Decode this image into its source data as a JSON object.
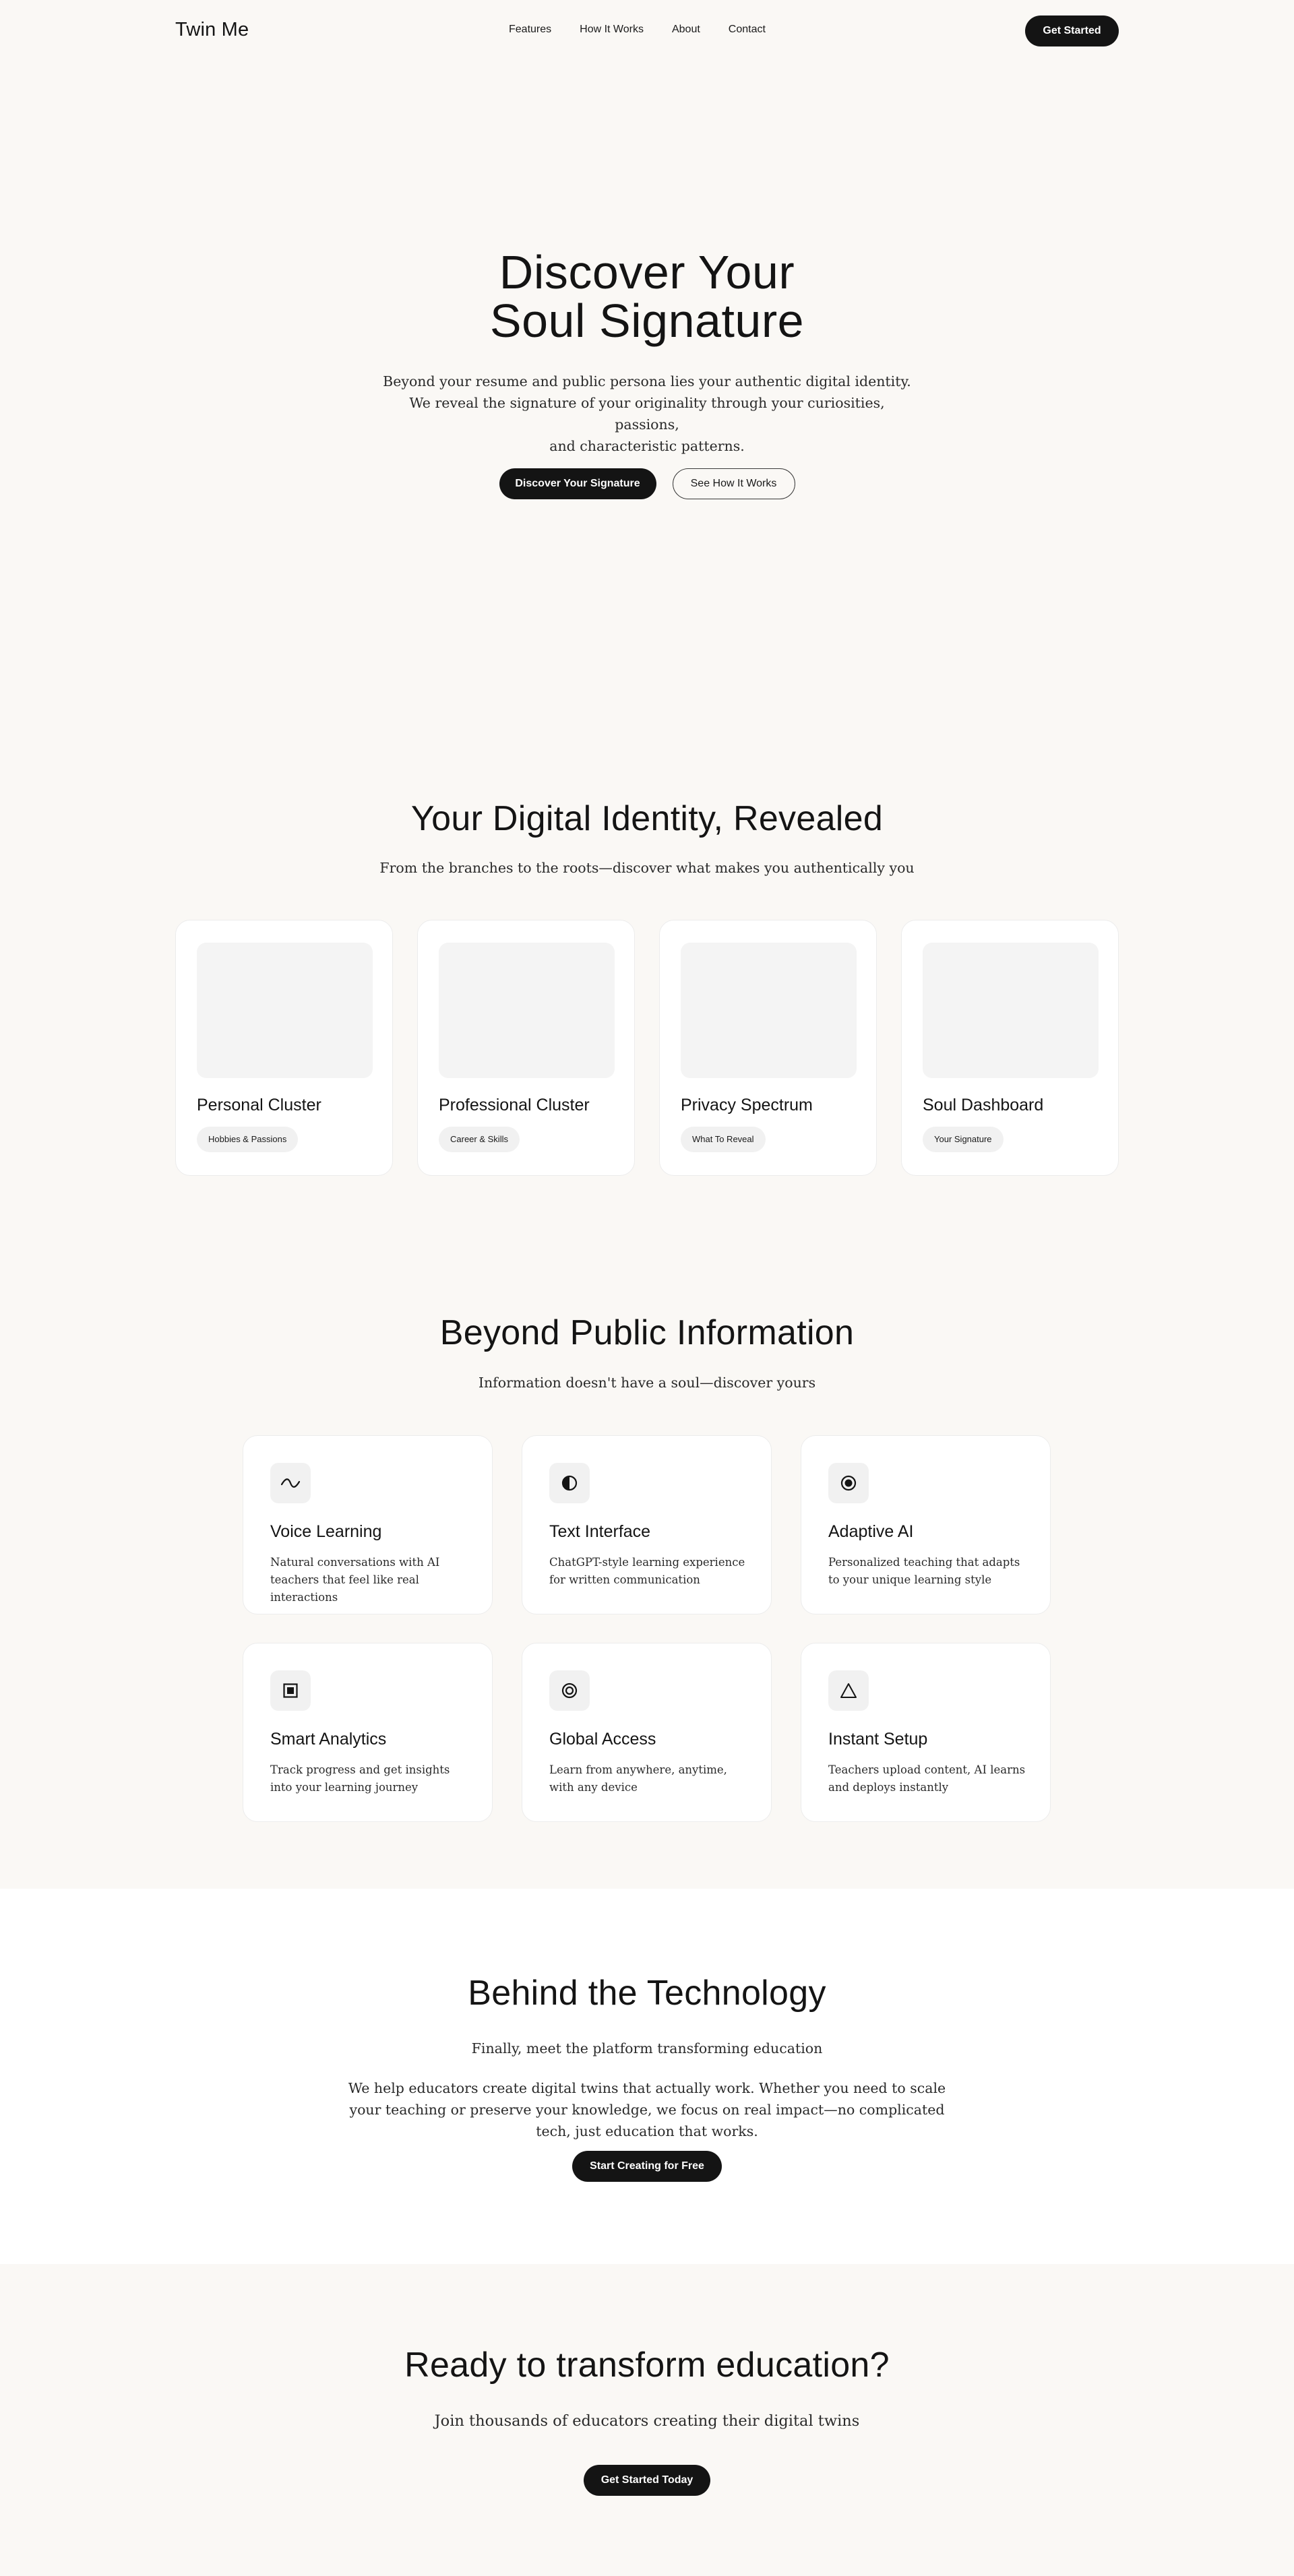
{
  "nav": {
    "logo": "Twin Me",
    "links": [
      "Features",
      "How It Works",
      "About",
      "Contact"
    ],
    "cta": "Get Started"
  },
  "hero": {
    "title_line1": "Discover Your",
    "title_line2": "Soul Signature",
    "subtitle_line1": "Beyond your resume and public persona lies your authentic digital identity.",
    "subtitle_line2": "We reveal the signature of your originality through your curiosities, passions,",
    "subtitle_line3": "and characteristic patterns.",
    "primary_button": "Discover Your Signature",
    "secondary_button": "See How It Works"
  },
  "identity": {
    "title": "Your Digital Identity, Revealed",
    "subtitle": "From the branches to the roots—discover what makes you authentically you",
    "cards": [
      {
        "title": "Personal Cluster",
        "tag": "Hobbies & Passions"
      },
      {
        "title": "Professional Cluster",
        "tag": "Career & Skills"
      },
      {
        "title": "Privacy Spectrum",
        "tag": "What To Reveal"
      },
      {
        "title": "Soul Dashboard",
        "tag": "Your Signature"
      }
    ]
  },
  "features": {
    "title": "Beyond Public Information",
    "subtitle": "Information doesn't have a soul—discover yours",
    "items": [
      {
        "icon": "wave-icon",
        "title": "Voice Learning",
        "desc": "Natural conversations with AI teachers that feel like real interactions"
      },
      {
        "icon": "half-circle-icon",
        "title": "Text Interface",
        "desc": "ChatGPT-style learning experience for written communication"
      },
      {
        "icon": "target-icon",
        "title": "Adaptive AI",
        "desc": "Personalized teaching that adapts to your unique learning style"
      },
      {
        "icon": "square-dot-icon",
        "title": "Smart Analytics",
        "desc": "Track progress and get insights into your learning journey"
      },
      {
        "icon": "concentric-circle-icon",
        "title": "Global Access",
        "desc": "Learn from anywhere, anytime, with any device"
      },
      {
        "icon": "triangle-icon",
        "title": "Instant Setup",
        "desc": "Teachers upload content, AI learns and deploys instantly"
      }
    ]
  },
  "technology": {
    "title": "Behind the Technology",
    "subtitle": "Finally, meet the platform transforming education",
    "body": "We help educators create digital twins that actually work. Whether you need to scale your teaching or preserve your knowledge, we focus on real impact—no complicated tech, just education that works.",
    "button": "Start Creating for Free"
  },
  "cta": {
    "title": "Ready to transform education?",
    "subtitle": "Join thousands of educators creating their digital twins",
    "button": "Get Started Today"
  },
  "colors": {
    "background": "#faf8f5",
    "card": "#ffffff",
    "dark": "#141414",
    "placeholder": "#f4f4f4"
  }
}
